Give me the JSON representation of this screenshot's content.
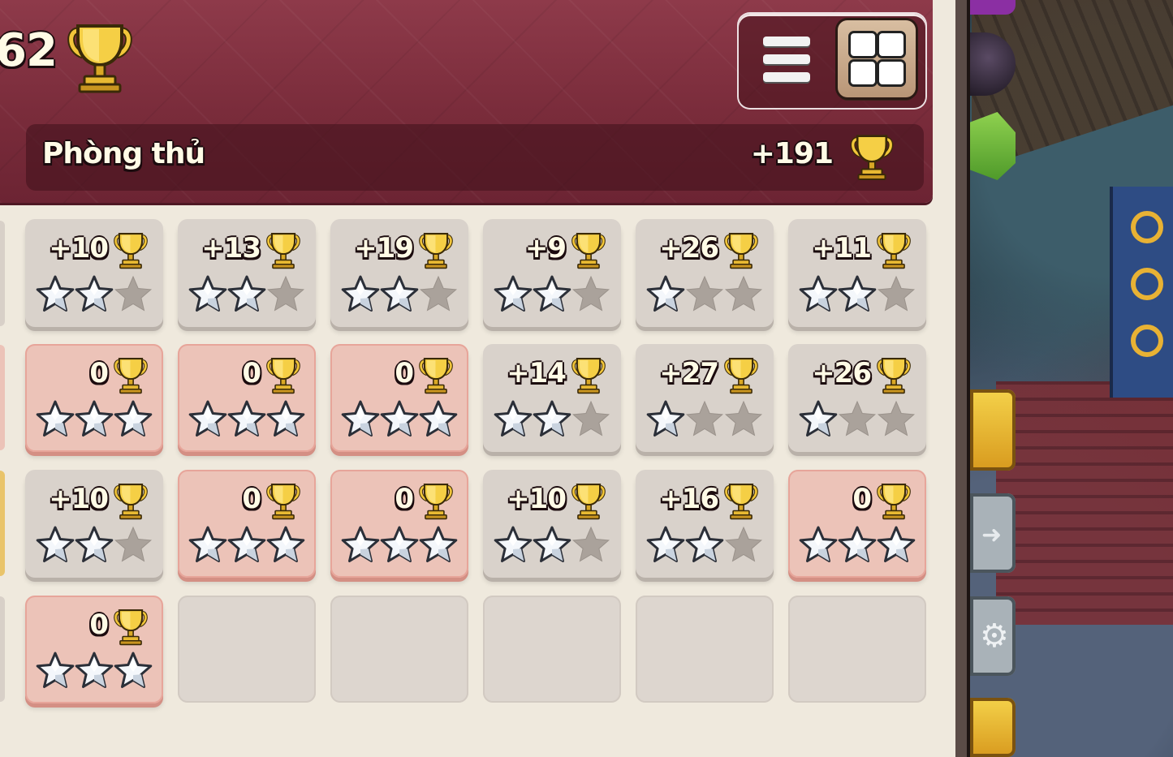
{
  "header": {
    "trophy_count": "62",
    "defense_label": "Phòng thủ",
    "defense_total": "+191"
  },
  "view_buttons": {
    "list_icon": "list-icon",
    "grid_icon": "grid-icon"
  },
  "colors": {
    "header_bg": "#7a2c3b",
    "card_bg": "#d9d2cb",
    "card_full_bg": "#ecc3b8",
    "star_earned": "#f4f7fb",
    "star_empty": "#aaa29b",
    "trophy_gold": "#f3c63a"
  },
  "defenses": [
    {
      "trophies": "+10",
      "stars": 2
    },
    {
      "trophies": "+13",
      "stars": 2
    },
    {
      "trophies": "+19",
      "stars": 2
    },
    {
      "trophies": "+9",
      "stars": 2
    },
    {
      "trophies": "+26",
      "stars": 1
    },
    {
      "trophies": "+11",
      "stars": 2
    },
    {
      "trophies": "0",
      "stars": 3
    },
    {
      "trophies": "0",
      "stars": 3
    },
    {
      "trophies": "0",
      "stars": 3
    },
    {
      "trophies": "+14",
      "stars": 2
    },
    {
      "trophies": "+27",
      "stars": 1
    },
    {
      "trophies": "+26",
      "stars": 1
    },
    {
      "trophies": "+10",
      "stars": 2
    },
    {
      "trophies": "0",
      "stars": 3
    },
    {
      "trophies": "0",
      "stars": 3
    },
    {
      "trophies": "+10",
      "stars": 2
    },
    {
      "trophies": "+16",
      "stars": 2
    },
    {
      "trophies": "0",
      "stars": 3
    },
    {
      "trophies": "0",
      "stars": 3
    }
  ],
  "empty_slots": 5
}
